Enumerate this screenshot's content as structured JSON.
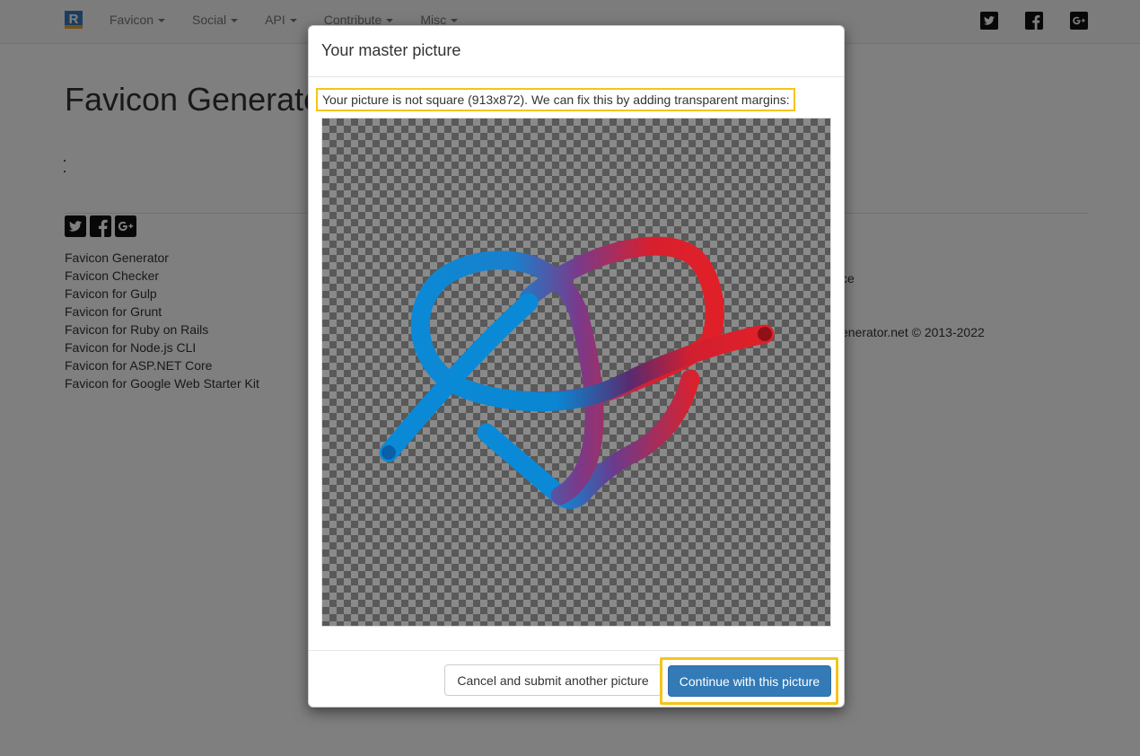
{
  "navbar": {
    "brand_letter": "R",
    "items": [
      {
        "label": "Favicon"
      },
      {
        "label": "Social"
      },
      {
        "label": "API"
      },
      {
        "label": "Contribute"
      },
      {
        "label": "Misc"
      }
    ],
    "social_icons": [
      "twitter-icon",
      "facebook-icon",
      "google-plus-icon"
    ]
  },
  "page": {
    "title": "Favicon Generator"
  },
  "footer": {
    "social_icons": [
      "twitter-icon",
      "facebook-icon",
      "google-plus-icon"
    ],
    "links": [
      "Favicon Generator",
      "Favicon Checker",
      "Favicon for Gulp",
      "Favicon for Grunt",
      "Favicon for Ruby on Rails",
      "Favicon for Node.js CLI",
      "Favicon for ASP.NET Core",
      "Favicon for Google Web Starter Kit"
    ],
    "right_text_1": "ce",
    "right_text_2": "enerator.net © 2013-2022"
  },
  "modal": {
    "title": "Your master picture",
    "notice": "Your picture is not square (913x872). We can fix this by adding transparent margins:",
    "cancel_label": "Cancel and submit another picture",
    "continue_label": "Continue with this picture"
  },
  "colors": {
    "primary": "#337ab7",
    "highlight": "#f5c518",
    "knot_blue": "#0a8ad6",
    "knot_red": "#e02028"
  }
}
